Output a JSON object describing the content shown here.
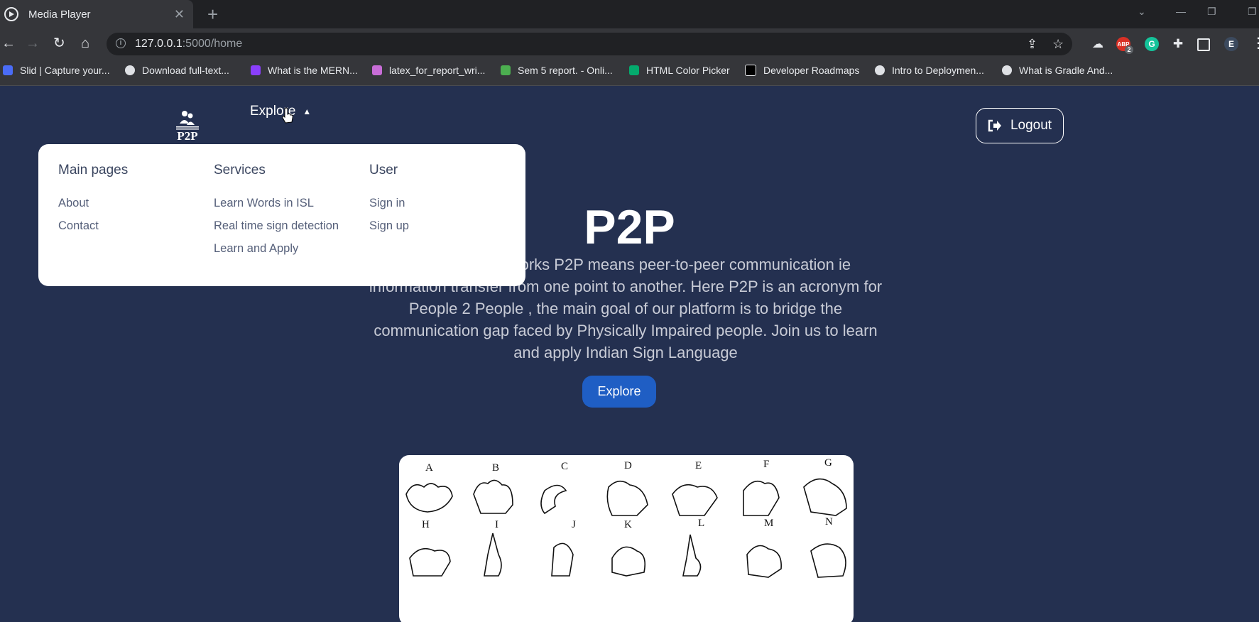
{
  "browser": {
    "tab_title": "Media Player",
    "url_host": "127.0.0.1",
    "url_path": ":5000/home",
    "profile_initial": "E",
    "abp_badge": "2"
  },
  "bookmarks": [
    {
      "label": "Slid | Capture your...",
      "color": "#4a6cf7"
    },
    {
      "label": "Download full-text...",
      "color": "#dfe1e5"
    },
    {
      "label": "What is the MERN...",
      "color": "#8a3ffc"
    },
    {
      "label": "latex_for_report_wri...",
      "color": "#c86dd7"
    },
    {
      "label": "Sem 5 report. - Onli...",
      "color": "#4caf50"
    },
    {
      "label": "HTML Color Picker",
      "color": "#04aa6d"
    },
    {
      "label": "Developer Roadmaps",
      "color": "#000000"
    },
    {
      "label": "Intro to Deploymen...",
      "color": "#dfe1e5"
    },
    {
      "label": "What is Gradle And...",
      "color": "#dfe1e5"
    }
  ],
  "nav": {
    "logo_text": "P2P",
    "explore_label": "Explore",
    "logout_label": "Logout"
  },
  "dropdown": {
    "columns": [
      {
        "heading": "Main pages",
        "links": [
          "About",
          "Contact"
        ]
      },
      {
        "heading": "Services",
        "links": [
          "Learn Words in ISL",
          "Real time sign detection",
          "Learn and Apply"
        ]
      },
      {
        "heading": "User",
        "links": [
          "Sign in",
          "Sign up"
        ]
      }
    ]
  },
  "hero": {
    "title": "P2P",
    "description": "In computer networks P2P means peer-to-peer communication ie information transfer from one point to another. Here P2P is an acronym for People 2 People , the main goal of our platform is to bridge the communication gap faced by Physically Impaired people. Join us to learn and apply Indian Sign Language",
    "button_label": "Explore"
  },
  "sign_chart": {
    "row1": [
      "A",
      "B",
      "C",
      "D",
      "E",
      "F",
      "G"
    ],
    "row2": [
      "H",
      "I",
      "J",
      "K",
      "L",
      "M",
      "N"
    ]
  },
  "colors": {
    "page_bg": "#243050",
    "accent_button": "#1f5ec4",
    "dropdown_bg": "#ffffff"
  }
}
